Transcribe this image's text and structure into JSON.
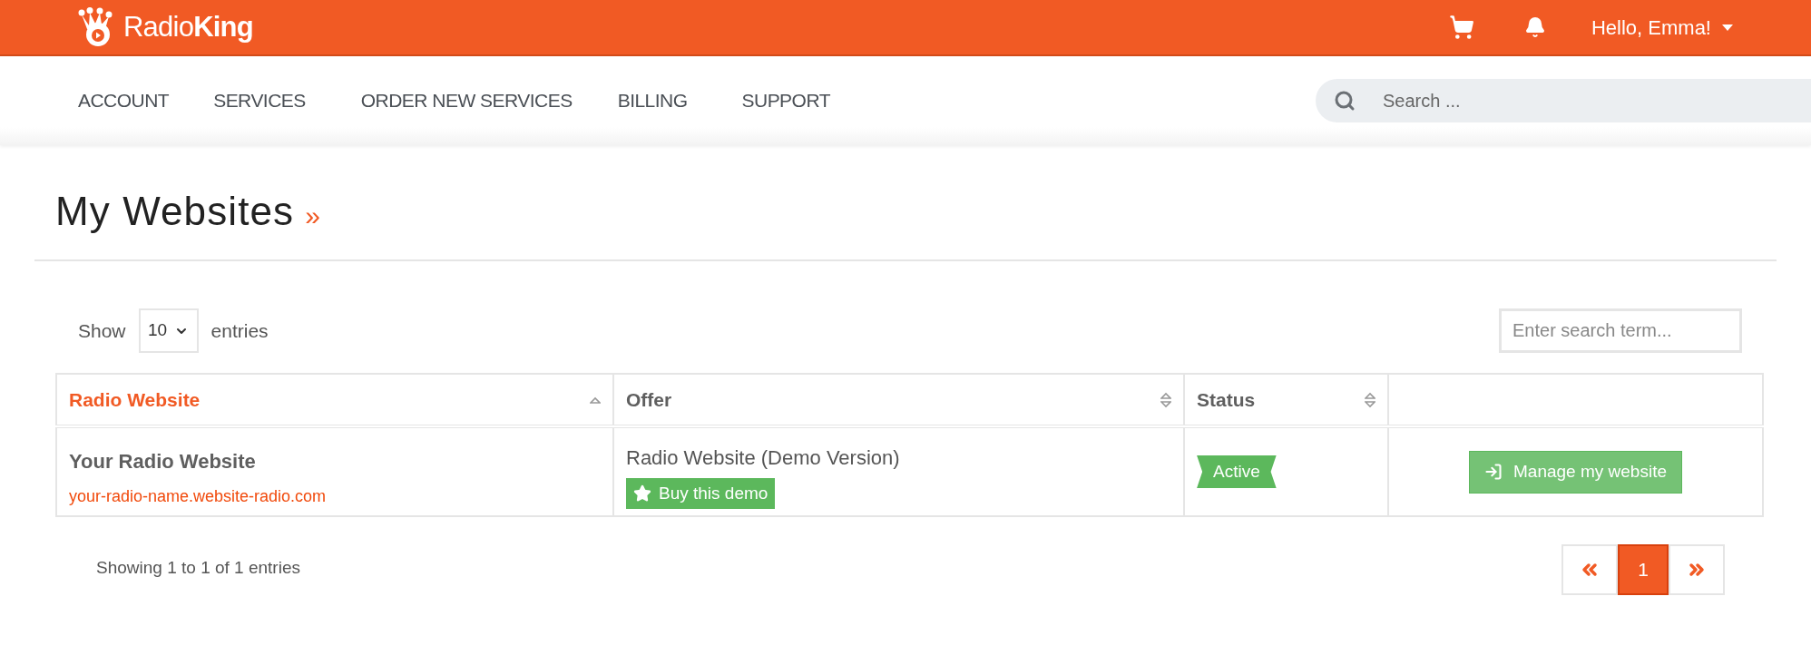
{
  "header": {
    "logo": "Radio**King**",
    "greeting": "Hello, Emma!"
  },
  "nav": {
    "items": [
      {
        "label": "ACCOUNT"
      },
      {
        "label": "SERVICES"
      },
      {
        "label": "ORDER NEW SERVICES"
      },
      {
        "label": "BILLING"
      },
      {
        "label": "SUPPORT"
      }
    ],
    "search": {
      "placeholder": "Search ..."
    }
  },
  "page": {
    "title": "My Websites",
    "title_mark": "»"
  },
  "controls": {
    "show_label": "Show",
    "page_size": "10",
    "entries_label": "entries",
    "filter": {
      "placeholder": "Enter search term..."
    }
  },
  "table": {
    "columns": [
      {
        "label": "Radio Website",
        "sorted": true
      },
      {
        "label": "Offer",
        "sorted": false
      },
      {
        "label": "Status",
        "sorted": false
      }
    ],
    "rows": [
      {
        "name": "Your Radio Website",
        "url": "your-radio-name.website-radio.com",
        "offer": "Radio Website (Demo Version)",
        "offer_button": "Buy this demo",
        "status": "Active",
        "action": "Manage my website"
      }
    ]
  },
  "footer": {
    "info": "Showing 1 to 1 of 1 entries",
    "pages": [
      {
        "label": "1",
        "selected": true
      }
    ]
  }
}
